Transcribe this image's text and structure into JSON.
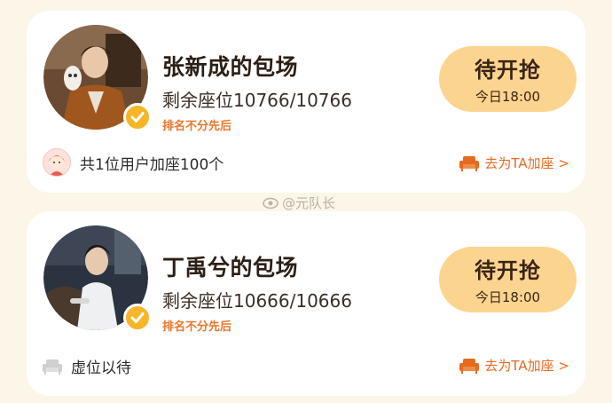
{
  "cards": [
    {
      "name": "张新成的包场",
      "seats": "剩余座位10766/10766",
      "rank_note": "排名不分先后",
      "status_title": "待开抢",
      "status_time": "今日18:00",
      "bottom_text": "共1位用户加座100个",
      "action_label": "去为TA加座 >"
    },
    {
      "name": "丁禹兮的包场",
      "seats": "剩余座位10666/10666",
      "rank_note": "排名不分先后",
      "status_title": "待开抢",
      "status_time": "今日18:00",
      "bottom_text": "虚位以待",
      "action_label": "去为TA加座 >"
    }
  ],
  "watermark": "@元队长",
  "colors": {
    "background": "#fbf6e8",
    "status_pill": "#fbd58f",
    "accent_orange": "#e8762a",
    "badge": "#f7b52a"
  },
  "icons": [
    "verified-badge-icon",
    "sofa-seat-icon",
    "weibo-eye-icon"
  ]
}
